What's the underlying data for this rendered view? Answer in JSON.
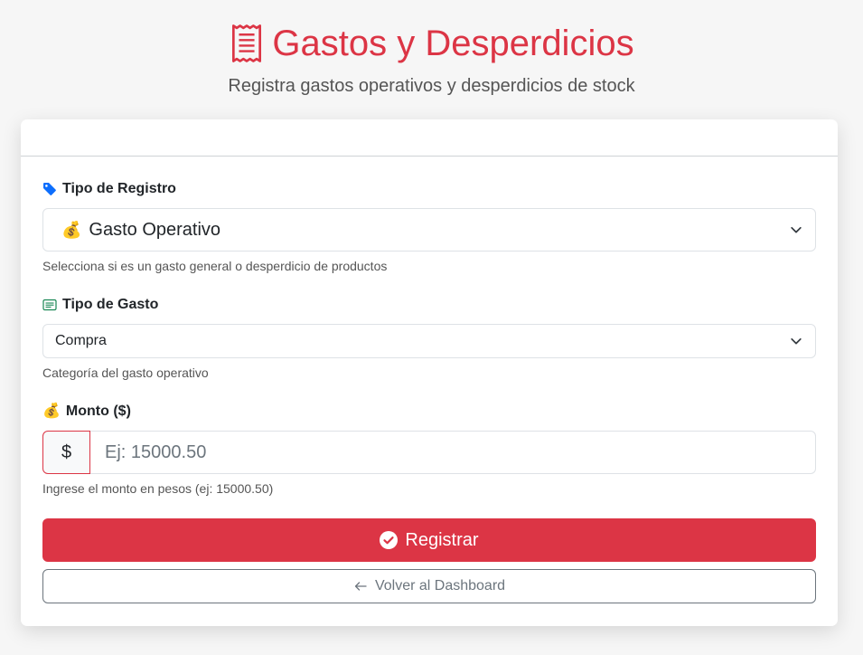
{
  "header": {
    "title": "Gastos y Desperdicios",
    "subtitle": "Registra gastos operativos y desperdicios de stock",
    "icon": "receipt-icon"
  },
  "form": {
    "tipo_registro": {
      "label": "Tipo de Registro",
      "icon": "tag-icon",
      "value_emoji": "💰",
      "value": "Gasto Operativo",
      "help": "Selecciona si es un gasto general o desperdicio de productos"
    },
    "tipo_gasto": {
      "label": "Tipo de Gasto",
      "icon": "card-text-icon",
      "value": "Compra",
      "help": "Categoría del gasto operativo"
    },
    "monto": {
      "label_emoji": "💰",
      "label": "Monto ($)",
      "prefix": "$",
      "placeholder": "Ej: 15000.50",
      "value": "",
      "help": "Ingrese el monto en pesos (ej: 15000.50)"
    },
    "submit_label": "Registrar",
    "back_label": "Volver al Dashboard"
  },
  "colors": {
    "accent": "#dc3545",
    "tag_icon": "#0d6efd",
    "card_icon": "#198754",
    "secondary": "#6c757d"
  }
}
